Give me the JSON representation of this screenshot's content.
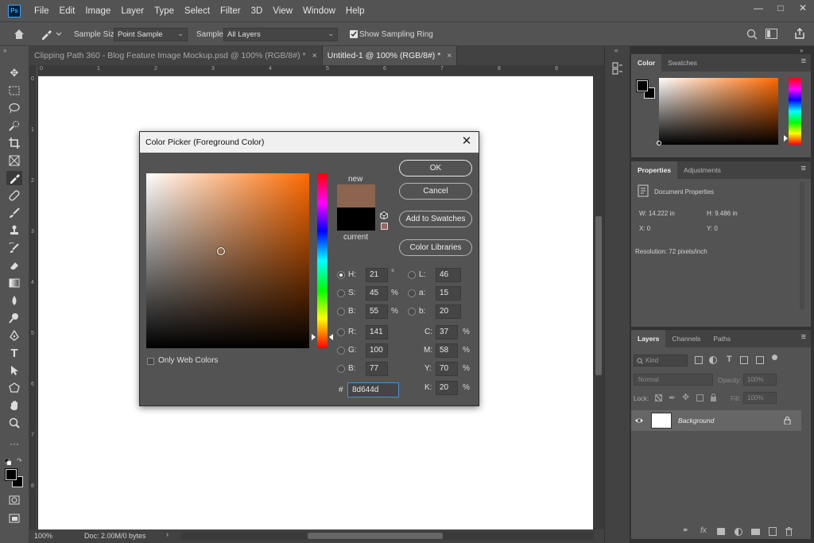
{
  "app": {
    "logo": "Ps"
  },
  "menu": [
    "File",
    "Edit",
    "Image",
    "Layer",
    "Type",
    "Select",
    "Filter",
    "3D",
    "View",
    "Window",
    "Help"
  ],
  "options_bar": {
    "sample_size_label": "Sample Size:",
    "sample_size_value": "Point Sample",
    "sample_label": "Sample:",
    "sample_value": "All Layers",
    "show_sampling_ring": "Show Sampling Ring"
  },
  "tabs": [
    {
      "label": "Clipping Path 360 - Blog Feature Image Mockup.psd @ 100% (RGB/8#) *",
      "active": false
    },
    {
      "label": "Untitled-1 @ 100% (RGB/8#) *",
      "active": true
    }
  ],
  "rulers": {
    "h": [
      "0",
      "1",
      "2",
      "3",
      "4",
      "5",
      "6",
      "7",
      "8",
      "9"
    ],
    "v": [
      "0",
      "1",
      "2",
      "3",
      "4",
      "5",
      "6",
      "7",
      "8"
    ]
  },
  "status": {
    "zoom": "100%",
    "doc": "Doc: 2.00M/0 bytes"
  },
  "color_panel": {
    "tabs": [
      "Color",
      "Swatches"
    ]
  },
  "properties_panel": {
    "tabs": [
      "Properties",
      "Adjustments"
    ],
    "heading": "Document Properties",
    "w": "W:  14.222 in",
    "h": "H:  9.486 in",
    "x": "X:  0",
    "y": "Y:  0",
    "resolution": "Resolution: 72 pixels/inch"
  },
  "layers_panel": {
    "tabs": [
      "Layers",
      "Channels",
      "Paths"
    ],
    "kind_placeholder": "Kind",
    "blend_mode": "Normal",
    "opacity_label": "Opacity:",
    "opacity_value": "100%",
    "lock_label": "Lock:",
    "fill_label": "Fill:",
    "fill_value": "100%",
    "layer_name": "Background"
  },
  "dialog": {
    "title": "Color Picker (Foreground Color)",
    "close": "✕",
    "new_label": "new",
    "current_label": "current",
    "buttons": {
      "ok": "OK",
      "cancel": "Cancel",
      "add_to_swatches": "Add to Swatches",
      "color_libraries": "Color Libraries"
    },
    "only_web_colors": "Only Web Colors",
    "channels": {
      "H": {
        "label": "H:",
        "value": "21",
        "unit": "°"
      },
      "S": {
        "label": "S:",
        "value": "45",
        "unit": "%"
      },
      "B": {
        "label": "B:",
        "value": "55",
        "unit": "%"
      },
      "R": {
        "label": "R:",
        "value": "141"
      },
      "G": {
        "label": "G:",
        "value": "100"
      },
      "Bl": {
        "label": "B:",
        "value": "77"
      },
      "L": {
        "label": "L:",
        "value": "46"
      },
      "a": {
        "label": "a:",
        "value": "15"
      },
      "b": {
        "label": "b:",
        "value": "20"
      },
      "C": {
        "label": "C:",
        "value": "37",
        "unit": "%"
      },
      "M": {
        "label": "M:",
        "value": "58",
        "unit": "%"
      },
      "Y": {
        "label": "Y:",
        "value": "70",
        "unit": "%"
      },
      "K": {
        "label": "K:",
        "value": "20",
        "unit": "%"
      }
    },
    "hex_label": "#",
    "hex_value": "8d644d",
    "colors": {
      "new": "#8d644d",
      "current": "#000000",
      "hue_base": "#ff6a00"
    }
  }
}
